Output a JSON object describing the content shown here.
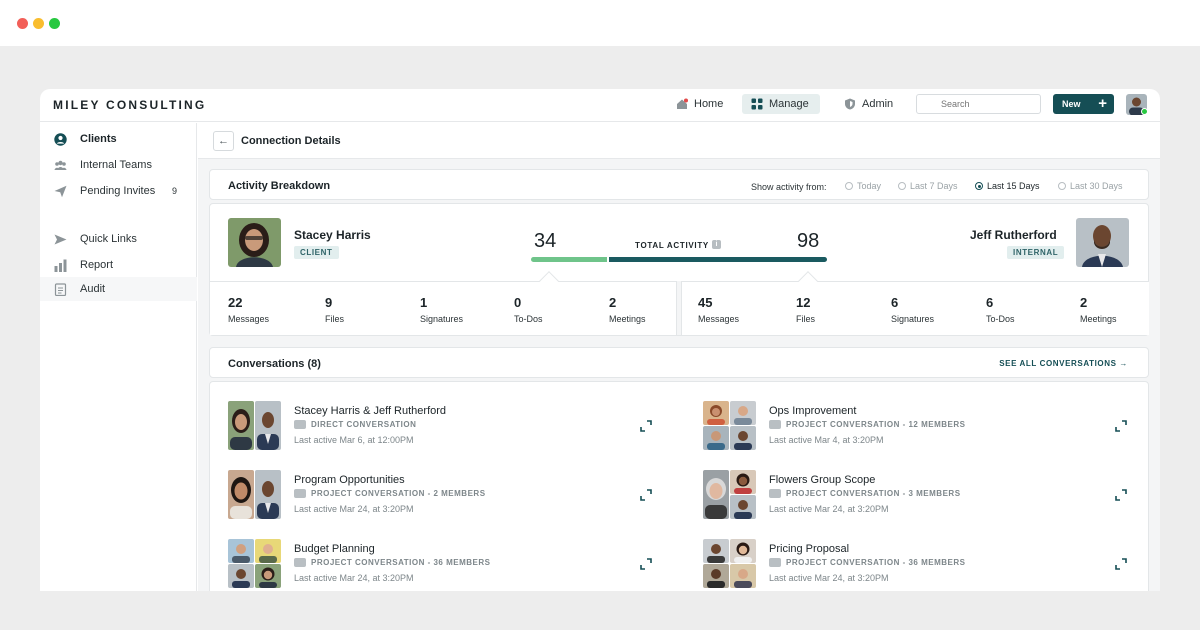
{
  "brand": "MILEY CONSULTING",
  "nav": {
    "home": "Home",
    "manage": "Manage",
    "admin": "Admin",
    "search_placeholder": "Search",
    "new_label": "New"
  },
  "sidebar": {
    "items": [
      {
        "label": "Clients",
        "icon": "client-icon"
      },
      {
        "label": "Internal Teams",
        "icon": "teams-icon"
      },
      {
        "label": "Pending Invites",
        "icon": "send-icon",
        "count": "9"
      },
      {
        "label": "Quick Links",
        "icon": "arrow-icon"
      },
      {
        "label": "Report",
        "icon": "bar-chart-icon"
      },
      {
        "label": "Audit",
        "icon": "clipboard-icon"
      }
    ]
  },
  "breadcrumb": {
    "title": "Connection Details"
  },
  "activity": {
    "title": "Activity Breakdown",
    "show_label": "Show activity from:",
    "ranges": [
      "Today",
      "Last 7 Days",
      "Last 15 Days",
      "Last 30 Days"
    ],
    "selected_range": "Last 15 Days",
    "total_label": "TOTAL ACTIVITY",
    "client": {
      "name": "Stacey Harris",
      "tag": "CLIENT",
      "total": 34,
      "stats": [
        {
          "value": "22",
          "label": "Messages"
        },
        {
          "value": "9",
          "label": "Files"
        },
        {
          "value": "1",
          "label": "Signatures"
        },
        {
          "value": "0",
          "label": "To-Dos"
        },
        {
          "value": "2",
          "label": "Meetings"
        }
      ]
    },
    "internal": {
      "name": "Jeff Rutherford",
      "tag": "INTERNAL",
      "total": 98,
      "stats": [
        {
          "value": "45",
          "label": "Messages"
        },
        {
          "value": "12",
          "label": "Files"
        },
        {
          "value": "6",
          "label": "Signatures"
        },
        {
          "value": "6",
          "label": "To-Dos"
        },
        {
          "value": "2",
          "label": "Meetings"
        }
      ]
    },
    "colors": {
      "client_bar": "#6fc48a",
      "internal_bar": "#1a5a60"
    }
  },
  "conversations": {
    "title": "Conversations (8)",
    "see_all": "SEE ALL CONVERSATIONS",
    "items": [
      {
        "title": "Stacey Harris & Jeff Rutherford",
        "type": "DIRECT CONVERSATION",
        "time": "Last active Mar 6, at 12:00PM"
      },
      {
        "title": "Ops Improvement",
        "type": "PROJECT CONVERSATION - 12 MEMBERS",
        "time": "Last active Mar 4, at 3:20PM"
      },
      {
        "title": "Program Opportunities",
        "type": "PROJECT CONVERSATION - 2 MEMBERS",
        "time": "Last active Mar 24, at 3:20PM"
      },
      {
        "title": "Flowers Group Scope",
        "type": "PROJECT CONVERSATION - 3 MEMBERS",
        "time": "Last active Mar 24, at 3:20PM"
      },
      {
        "title": "Budget Planning",
        "type": "PROJECT CONVERSATION - 36 MEMBERS",
        "time": "Last active Mar 24, at 3:20PM"
      },
      {
        "title": "Pricing Proposal",
        "type": "PROJECT CONVERSATION - 36 MEMBERS",
        "time": "Last active Mar 24, at 3:20PM"
      }
    ]
  }
}
